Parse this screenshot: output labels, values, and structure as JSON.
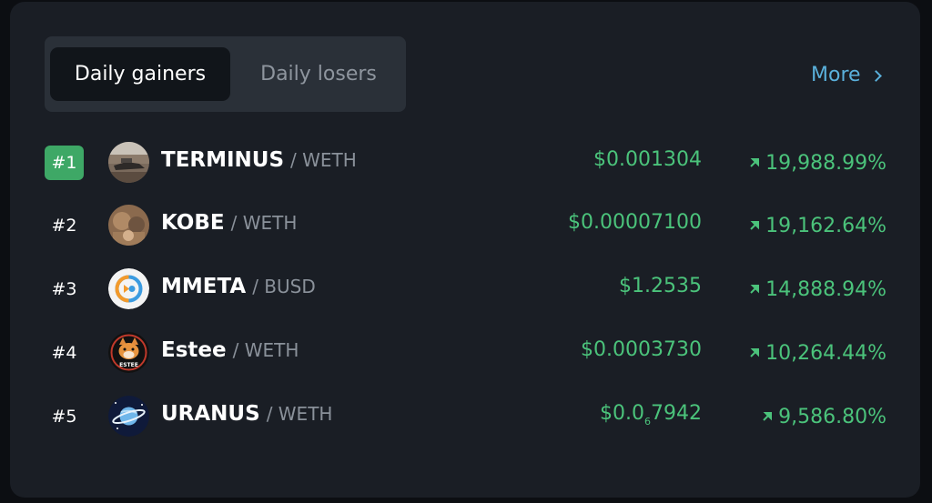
{
  "tabs": {
    "active": "Daily gainers",
    "inactive": "Daily losers"
  },
  "more_label": "More",
  "colors": {
    "positive": "#4bc37b",
    "link": "#5ab0db",
    "rank_highlight": "#3ea866"
  },
  "rows": [
    {
      "rank": "#1",
      "symbol": "TERMINUS",
      "quote": "/ WETH",
      "price": "$0.001304",
      "change": "19,988.99%",
      "direction": "up"
    },
    {
      "rank": "#2",
      "symbol": "KOBE",
      "quote": "/ WETH",
      "price": "$0.00007100",
      "change": "19,162.64%",
      "direction": "up"
    },
    {
      "rank": "#3",
      "symbol": "MMETA",
      "quote": "/ BUSD",
      "price": "$1.2535",
      "change": "14,888.94%",
      "direction": "up"
    },
    {
      "rank": "#4",
      "symbol": "Estee",
      "quote": "/ WETH",
      "price": "$0.0003730",
      "change": "10,264.44%",
      "direction": "up"
    },
    {
      "rank": "#5",
      "symbol": "URANUS",
      "quote": "/ WETH",
      "price_prefix": "$0.0",
      "price_sub": "6",
      "price_suffix": "7942",
      "change": "9,586.80%",
      "direction": "up"
    }
  ],
  "avatar_labels": {
    "estee": "ESTEE"
  }
}
